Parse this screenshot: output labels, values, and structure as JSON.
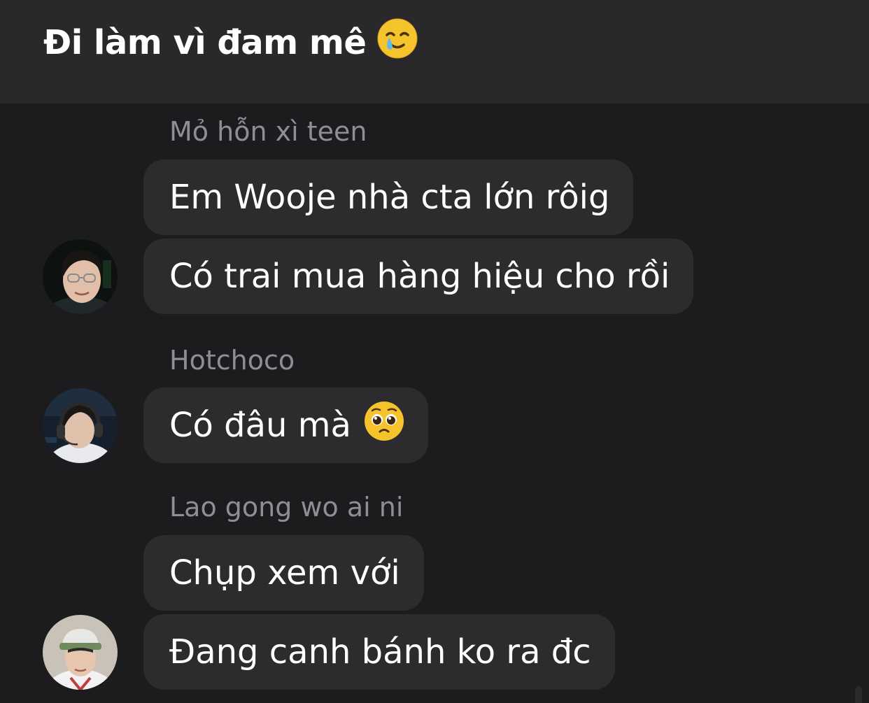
{
  "header": {
    "title": "Đi làm vì đam mê",
    "title_emoji": "smiling-face-with-tear-icon"
  },
  "messages": [
    {
      "sender": "Mỏ hỗn xì teen",
      "bubbles": [
        "Em Wooje nhà cta lớn rôig",
        "Có trai mua hàng hiệu cho rồi"
      ],
      "avatar": "user-avatar-glasses"
    },
    {
      "sender": "Hotchoco",
      "bubbles": [
        "Có đâu mà"
      ],
      "bubble_emoji": "pleading-face-icon",
      "avatar": "user-avatar-headset"
    },
    {
      "sender": "Lao gong wo ai ni",
      "bubbles": [
        "Chụp xem với",
        "Đang canh bánh ko ra đc"
      ],
      "avatar": "user-avatar-cap"
    }
  ],
  "colors": {
    "background": "#1c1c1e",
    "header": "#29292c",
    "bubble": "#2c2c2e",
    "sender_text": "#8e8e93",
    "text": "#ffffff"
  }
}
